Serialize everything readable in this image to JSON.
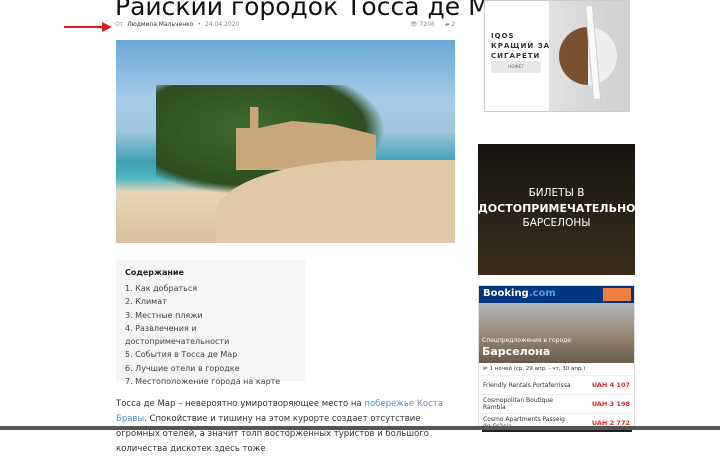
{
  "article": {
    "title": "Райский городок Тосса де Мар",
    "by": "От",
    "author": "Людмила Мальченко",
    "date": "24.04.2020",
    "views": "7206",
    "comments": "2"
  },
  "toc": {
    "heading": "Содержание",
    "items": [
      "1. Как добраться",
      "2. Климат",
      "3. Местные пляжи",
      "4. Развлечения и достопримечательности",
      "5. События в Тосса де Мар",
      "6. Лучшие отели в городке",
      "7. Местоположение города на карте"
    ]
  },
  "paragraph": {
    "text1": "Тосса де Мар – невероятно умиротворяющее место на ",
    "link": "побережье Коста Бравы",
    "text2": ". Спокойствие и тишину на этом курорте создает отсутствие огромных отелей, а значит толп восторженных туристов и большого количества дискотек здесь тоже"
  },
  "ad_iqos": {
    "line1": "IQOS",
    "line2": "КРАЩИЙ ЗА",
    "line3": "СИГАРЕТИ",
    "button": "НОЖЕТ"
  },
  "ad_tickets": {
    "line1": "БИЛЕТЫ В",
    "line2": "ДОСТОПРИМЕЧАТЕЛЬНОСТИ",
    "line3": "БАРСЕЛОНЫ"
  },
  "booking": {
    "brand1": "Booking",
    "brand2": ".com",
    "special": "Спецпредложения в городе",
    "city": "Барселона",
    "nights": "1 ночей (ср, 29 апр. - чт, 30 апр.)",
    "hotels": [
      {
        "name": "Friendly Rentals Portaferrissa",
        "price": "UAH 4 107"
      },
      {
        "name": "Cosmopolitan Boutique Rambla",
        "price": "UAH 3 198"
      },
      {
        "name": "Cosmo Apartments Passeig de Gràcia",
        "price": "UAH 2 772"
      }
    ]
  },
  "colors": {
    "accent_link": "#4a90c8",
    "booking_blue": "#003580",
    "price_red": "#d0312d",
    "arrow_red": "#e02020"
  }
}
